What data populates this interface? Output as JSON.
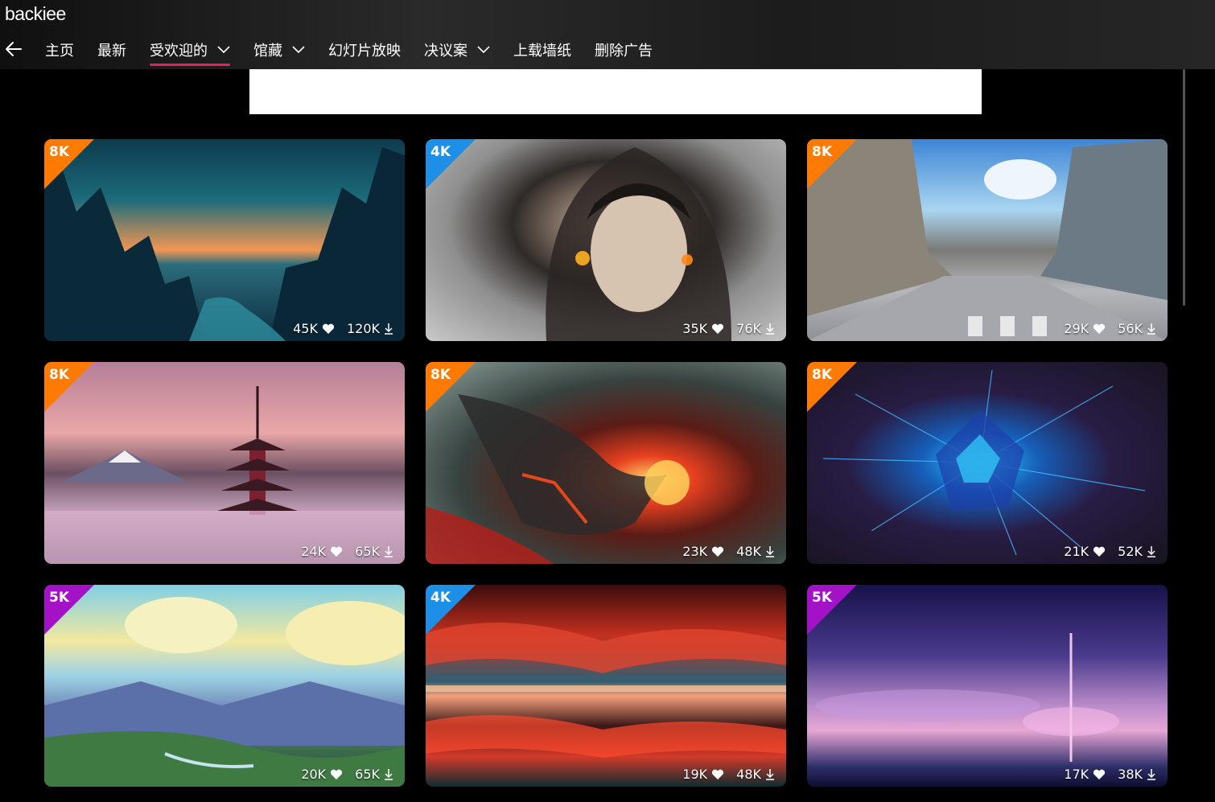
{
  "app": {
    "title": "backiee"
  },
  "nav": {
    "items": [
      {
        "label": "主页",
        "dropdown": false,
        "active": false
      },
      {
        "label": "最新",
        "dropdown": false,
        "active": false
      },
      {
        "label": "受欢迎的",
        "dropdown": true,
        "active": true
      },
      {
        "label": "馆藏",
        "dropdown": true,
        "active": false
      },
      {
        "label": "幻灯片放映",
        "dropdown": false,
        "active": false
      },
      {
        "label": "决议案",
        "dropdown": true,
        "active": false
      },
      {
        "label": "上载墙纸",
        "dropdown": false,
        "active": false
      },
      {
        "label": "删除广告",
        "dropdown": false,
        "active": false
      }
    ]
  },
  "colors": {
    "accent": "#e0245e",
    "res_8k": "#ff7a00",
    "res_4k": "#1e8fe6",
    "res_5k": "#a312c7"
  },
  "wallpapers": [
    {
      "res": "8K",
      "likes": "45K",
      "downloads": "120K",
      "subject": "forest-sunset"
    },
    {
      "res": "4K",
      "likes": "35K",
      "downloads": "76K",
      "subject": "hooded-girl"
    },
    {
      "res": "8K",
      "likes": "29K",
      "downloads": "56K",
      "subject": "anime-street"
    },
    {
      "res": "8K",
      "likes": "24K",
      "downloads": "65K",
      "subject": "pagoda-fuji"
    },
    {
      "res": "8K",
      "likes": "23K",
      "downloads": "48K",
      "subject": "fire-dragon"
    },
    {
      "res": "8K",
      "likes": "21K",
      "downloads": "52K",
      "subject": "neon-polygon-burst"
    },
    {
      "res": "5K",
      "likes": "20K",
      "downloads": "65K",
      "subject": "painted-valley"
    },
    {
      "res": "4K",
      "likes": "19K",
      "downloads": "48K",
      "subject": "red-cloud-reflection"
    },
    {
      "res": "5K",
      "likes": "17K",
      "downloads": "38K",
      "subject": "purple-sky"
    }
  ]
}
